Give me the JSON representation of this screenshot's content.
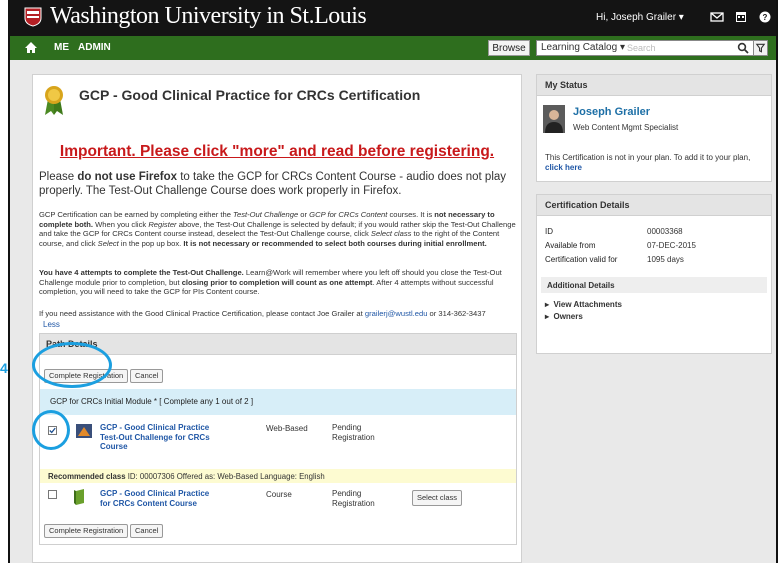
{
  "header": {
    "title": "Washington University in St.Louis",
    "user_greeting": "Hi, Joseph Grailer ▾",
    "icons": [
      "shield-icon",
      "mail-icon",
      "calendar-icon",
      "help-icon"
    ]
  },
  "nav": {
    "me": "ME",
    "admin": "ADMIN",
    "browse": "Browse",
    "catalog_select": "Learning Catalog  ▾",
    "search_placeholder": "Search"
  },
  "course": {
    "title": "GCP - Good Clinical Practice for CRCs Certification",
    "important_notice": "Important. Please click \"more\" and read before registering.",
    "firefox_pre": "Please ",
    "firefox_bold": "do not use Firefox",
    "firefox_post": " to take the GCP for CRCs Content Course - audio does not play properly. The Test-Out Challenge Course does work properly in Firefox.",
    "p1_a": "GCP Certification can be earned by completing either the ",
    "p1_b": "Test-Out Challenge",
    "p1_c": " or ",
    "p1_d": "GCP for CRCs Content",
    "p1_e": " courses. It is ",
    "p1_f": "not necessary to complete both.",
    "p1_g": " When you click ",
    "p1_h": "Register",
    "p1_i": " above, the Test-Out Challenge is selected by default; if you would rather skip the Test-Out Challenge and take the GCP for CRCs Content course instead, deselect the Test-Out Challenge course, click ",
    "p1_j": "Select class",
    "p1_k": " to the right of the Content course, and click ",
    "p1_l": "Select",
    "p1_m": " in the pop up box. ",
    "p1_n": "It is not necessary or recommended to select both courses during initial enrollment.",
    "p2_a": "You have 4 attempts to complete the Test-Out Challenge.",
    "p2_b": " Learn@Work will remember where you left off should you close the Test-Out Challenge module prior to completion, but ",
    "p2_c": "closing prior to completion will count as one attempt",
    "p2_d": ". After 4 attempts without successful completion, you will need to take the GCP for PIs Content course.",
    "p3_a": "If you need assistance with the Good Clinical Practice Certification, please contact Joe Grailer at ",
    "p3_email": "grailerj@wustl.edu",
    "p3_b": " or 314-362-3437",
    "less_link": "Less"
  },
  "path": {
    "title": "Path Details",
    "complete_registration": "Complete Registration",
    "cancel": "Cancel",
    "module_label": "GCP for CRCs Initial Module * [ Complete any 1 out of 2 ]",
    "items": [
      {
        "title_line1": "GCP - Good Clinical Practice",
        "title_line2": "Test-Out Challenge for CRCs",
        "title_line3": "Course",
        "type": "Web-Based",
        "status_line1": "Pending",
        "status_line2": "Registration",
        "checked": true
      },
      {
        "title_line1": "GCP - Good Clinical Practice",
        "title_line2": "for CRCs Content Course",
        "type": "Course",
        "status_line1": "Pending",
        "status_line2": "Registration",
        "checked": false,
        "action": "Select class"
      }
    ],
    "recommended_label": "Recommended class",
    "recommended_info": "  ID: 00007306  Offered as: Web-Based  Language: English"
  },
  "annotations": {
    "step_number": "4",
    "ring_color": "#1b9fe0"
  },
  "my_status": {
    "title": "My Status",
    "name": "Joseph Grailer",
    "role": "Web Content Mgmt Specialist",
    "plan_text": "This Certification is not in your plan. To add it to your plan,",
    "click_here": "click here"
  },
  "cert_details": {
    "title": "Certification Details",
    "id_label": "ID",
    "id_value": "00003368",
    "avail_label": "Available from",
    "avail_value": "07-DEC-2015",
    "valid_label": "Certification valid for",
    "valid_value": "1095 days",
    "additional_title": "Additional Details",
    "view_attachments": "View Attachments",
    "owners": "Owners"
  },
  "colors": {
    "header_bg": "#141414",
    "nav_green": "#2e6e1e",
    "important_red": "#c8191b",
    "link_blue": "#2057a6",
    "module_bg": "#d7eef8",
    "rec_bg": "#fdfbd1"
  }
}
